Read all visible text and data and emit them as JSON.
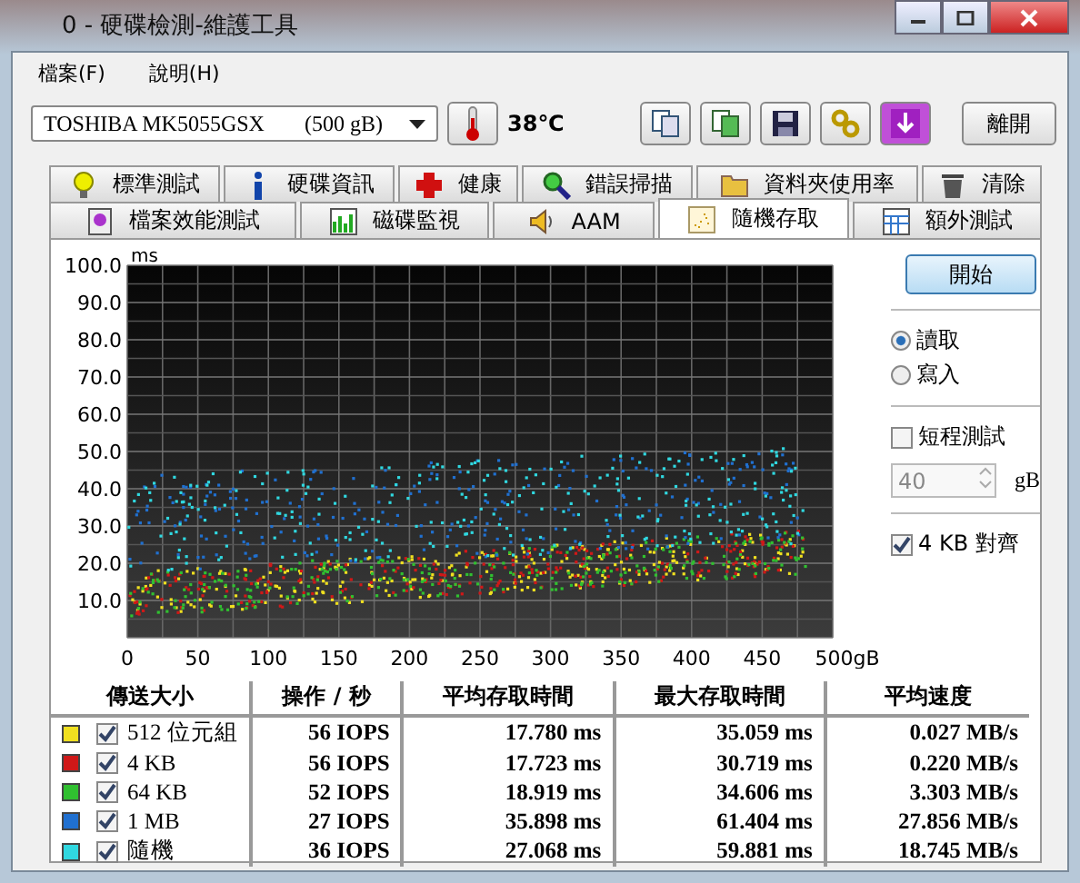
{
  "window": {
    "title": "0 - 硬碟檢測-維護工具"
  },
  "menu": [
    {
      "label": "檔案(F)"
    },
    {
      "label": "說明(H)"
    }
  ],
  "drive": {
    "name": "TOSHIBA MK5055GSX",
    "size": "(500 gB)"
  },
  "temperature": "38℃",
  "exit_button": "離開",
  "tab_rows": [
    [
      {
        "label": "標準測試",
        "kind": "bulb",
        "selected": false
      },
      {
        "label": "硬碟資訊",
        "kind": "info",
        "selected": false
      },
      {
        "label": "健康",
        "kind": "plus",
        "selected": false
      },
      {
        "label": "錯誤掃描",
        "kind": "magnifier",
        "selected": false
      },
      {
        "label": "資料夾使用率",
        "kind": "folder",
        "selected": false
      },
      {
        "label": "清除",
        "kind": "trash",
        "selected": false
      }
    ],
    [
      {
        "label": "檔案效能測試",
        "kind": "file",
        "selected": false
      },
      {
        "label": "磁碟監視",
        "kind": "bars",
        "selected": false
      },
      {
        "label": "AAM",
        "kind": "speaker",
        "selected": false
      },
      {
        "label": "隨機存取",
        "kind": "dots",
        "selected": true
      },
      {
        "label": "額外測試",
        "kind": "grid",
        "selected": false
      }
    ]
  ],
  "chart": {
    "y_unit": "ms",
    "y_ticks": [
      "100.0",
      "90.0",
      "80.0",
      "70.0",
      "60.0",
      "50.0",
      "40.0",
      "30.0",
      "20.0",
      "10.0"
    ],
    "x_ticks": [
      "0",
      "50",
      "100",
      "150",
      "200",
      "250",
      "300",
      "350",
      "400",
      "450",
      "500gB"
    ]
  },
  "start_button": "開始",
  "mode": [
    {
      "label": "讀取",
      "selected": true
    },
    {
      "label": "寫入",
      "selected": false
    }
  ],
  "short_test": {
    "label": "短程測試",
    "checked": false,
    "value": "40",
    "unit": "gB"
  },
  "align_4kb": {
    "label": "4 KB 對齊",
    "checked": true
  },
  "table": {
    "columns": [
      "傳送大小",
      "操作 / 秒",
      "平均存取時間",
      "最大存取時間",
      "平均速度"
    ],
    "rows": [
      {
        "color": "#f0e020",
        "checked": true,
        "size": "512 位元組",
        "ops": "56 IOPS",
        "avg": "17.780 ms",
        "max": "35.059 ms",
        "speed": "0.027 MB/s"
      },
      {
        "color": "#d01818",
        "checked": true,
        "size": "4 KB",
        "ops": "56 IOPS",
        "avg": "17.723 ms",
        "max": "30.719 ms",
        "speed": "0.220 MB/s"
      },
      {
        "color": "#30c030",
        "checked": true,
        "size": "64 KB",
        "ops": "52 IOPS",
        "avg": "18.919 ms",
        "max": "34.606 ms",
        "speed": "3.303 MB/s"
      },
      {
        "color": "#2070d0",
        "checked": true,
        "size": "1 MB",
        "ops": "27 IOPS",
        "avg": "35.898 ms",
        "max": "61.404 ms",
        "speed": "27.856 MB/s"
      },
      {
        "color": "#30d8e0",
        "checked": true,
        "size": "隨機",
        "ops": "36 IOPS",
        "avg": "27.068 ms",
        "max": "59.881 ms",
        "speed": "18.745 MB/s"
      }
    ]
  }
}
